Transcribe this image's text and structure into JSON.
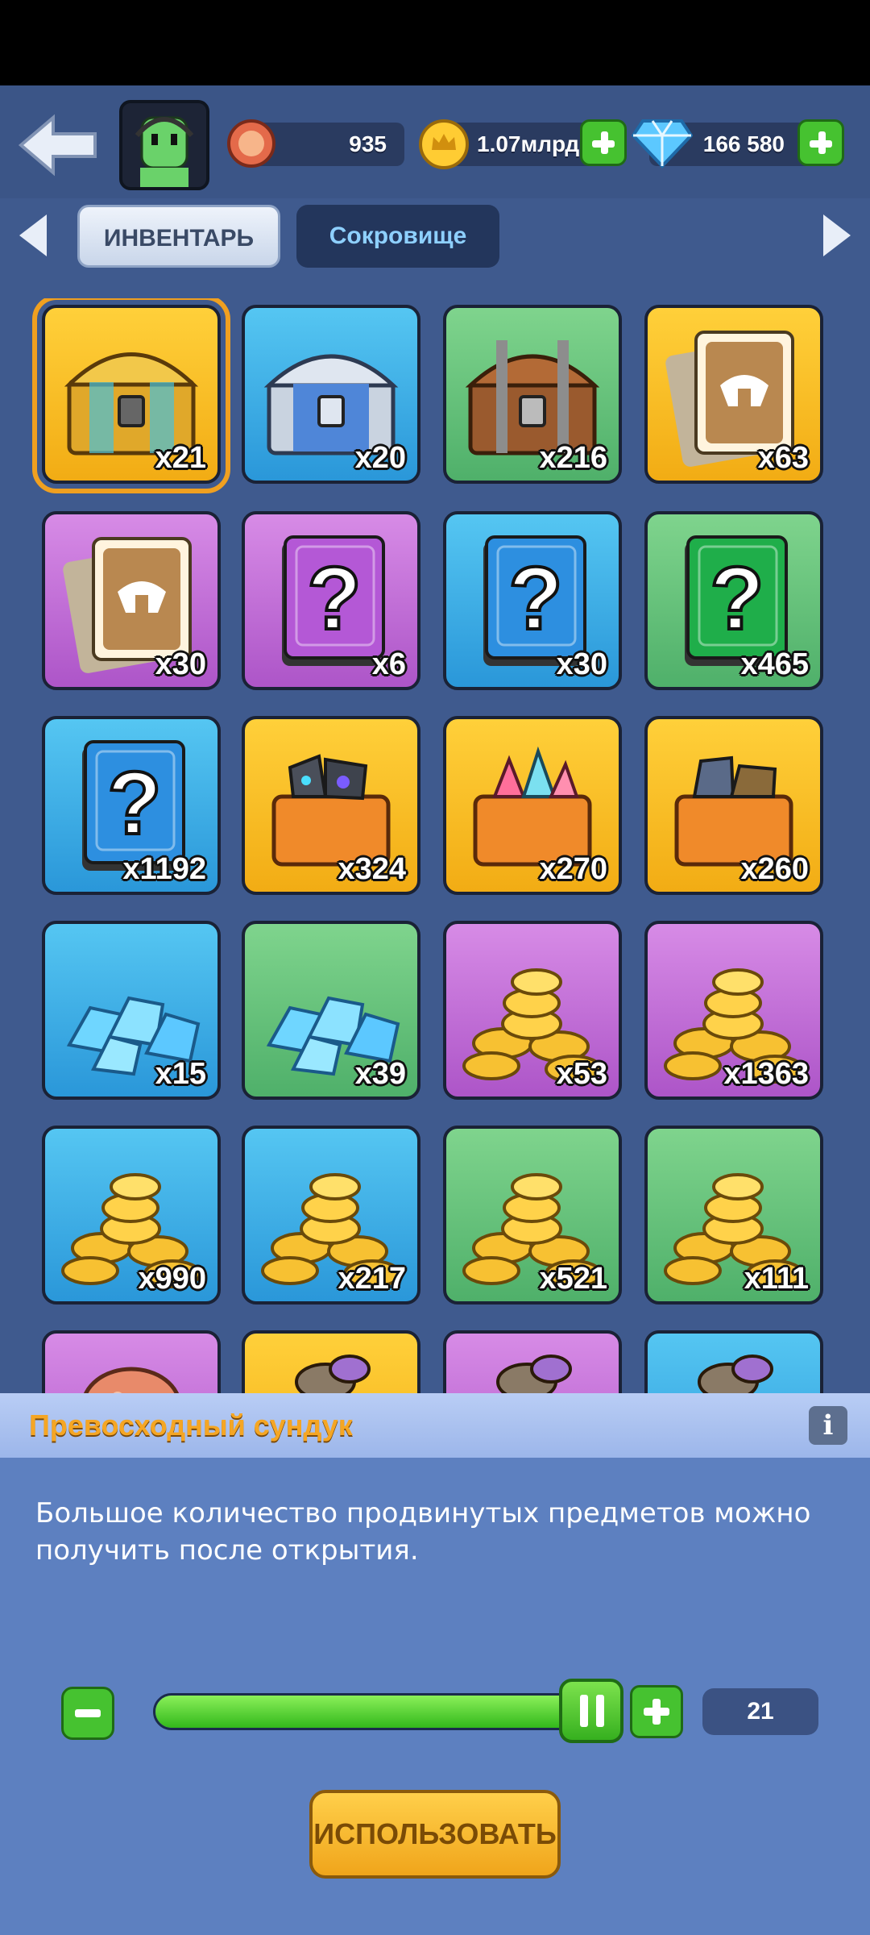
{
  "header": {
    "resources": [
      {
        "name": "energy",
        "icon": "energy-medal-icon",
        "value": "935"
      },
      {
        "name": "gold",
        "icon": "crown-coin-icon",
        "value": "1.07млрд"
      },
      {
        "name": "diamonds",
        "icon": "diamond-icon",
        "value": "166 580"
      }
    ]
  },
  "tabs": [
    {
      "label": "ИНВЕНТАРЬ",
      "active": true
    },
    {
      "label": "Сокровище",
      "active": false
    }
  ],
  "inventory": [
    {
      "item": "gold-chest",
      "bg": "gold",
      "qty": "x21",
      "selected": true
    },
    {
      "item": "silver-chest",
      "bg": "blue",
      "qty": "x20"
    },
    {
      "item": "wooden-chest",
      "bg": "green",
      "qty": "x216"
    },
    {
      "item": "hero-card",
      "bg": "gold",
      "qty": "x63"
    },
    {
      "item": "hero-card",
      "bg": "purple",
      "qty": "x30"
    },
    {
      "item": "mystery-book",
      "bg": "purple",
      "qty": "x6"
    },
    {
      "item": "mystery-book",
      "bg": "blue",
      "qty": "x30"
    },
    {
      "item": "mystery-book",
      "bg": "green",
      "qty": "x465"
    },
    {
      "item": "mystery-book",
      "bg": "blue",
      "qty": "x1192"
    },
    {
      "item": "rune-crate",
      "bg": "gold",
      "qty": "x324"
    },
    {
      "item": "gem-crate",
      "bg": "gold",
      "qty": "x270"
    },
    {
      "item": "ore-crate",
      "bg": "gold",
      "qty": "x260"
    },
    {
      "item": "crystal-pile",
      "bg": "blue",
      "qty": "x15"
    },
    {
      "item": "crystal-pile",
      "bg": "green",
      "qty": "x39"
    },
    {
      "item": "coin-pile",
      "bg": "purple",
      "qty": "x53"
    },
    {
      "item": "coin-pile",
      "bg": "purple",
      "qty": "x1363"
    },
    {
      "item": "coin-pile",
      "bg": "blue",
      "qty": "x990"
    },
    {
      "item": "coin-pile",
      "bg": "blue",
      "qty": "x217"
    },
    {
      "item": "coin-pile",
      "bg": "green",
      "qty": "x521"
    },
    {
      "item": "coin-pile",
      "bg": "green",
      "qty": "x111"
    },
    {
      "item": "meat",
      "bg": "purple",
      "qty": ""
    },
    {
      "item": "item-partial",
      "bg": "gold",
      "qty": ""
    },
    {
      "item": "item-partial",
      "bg": "purple",
      "qty": ""
    },
    {
      "item": "item-partial",
      "bg": "blue",
      "qty": ""
    }
  ],
  "detail": {
    "title": "Превосходный сундук",
    "info_label": "i",
    "description": "Большое количество продвинутых предметов можно получить после открытия.",
    "slider": {
      "min": 1,
      "max": 21,
      "value": 21
    },
    "count": "21",
    "use_label": "ИСПОЛЬЗОВАТЬ"
  },
  "colors": {
    "gold": "#f5b421",
    "blue": "#3aa9e6",
    "green": "#5fbf77",
    "purple": "#c06ad6",
    "accent": "#46c230"
  }
}
